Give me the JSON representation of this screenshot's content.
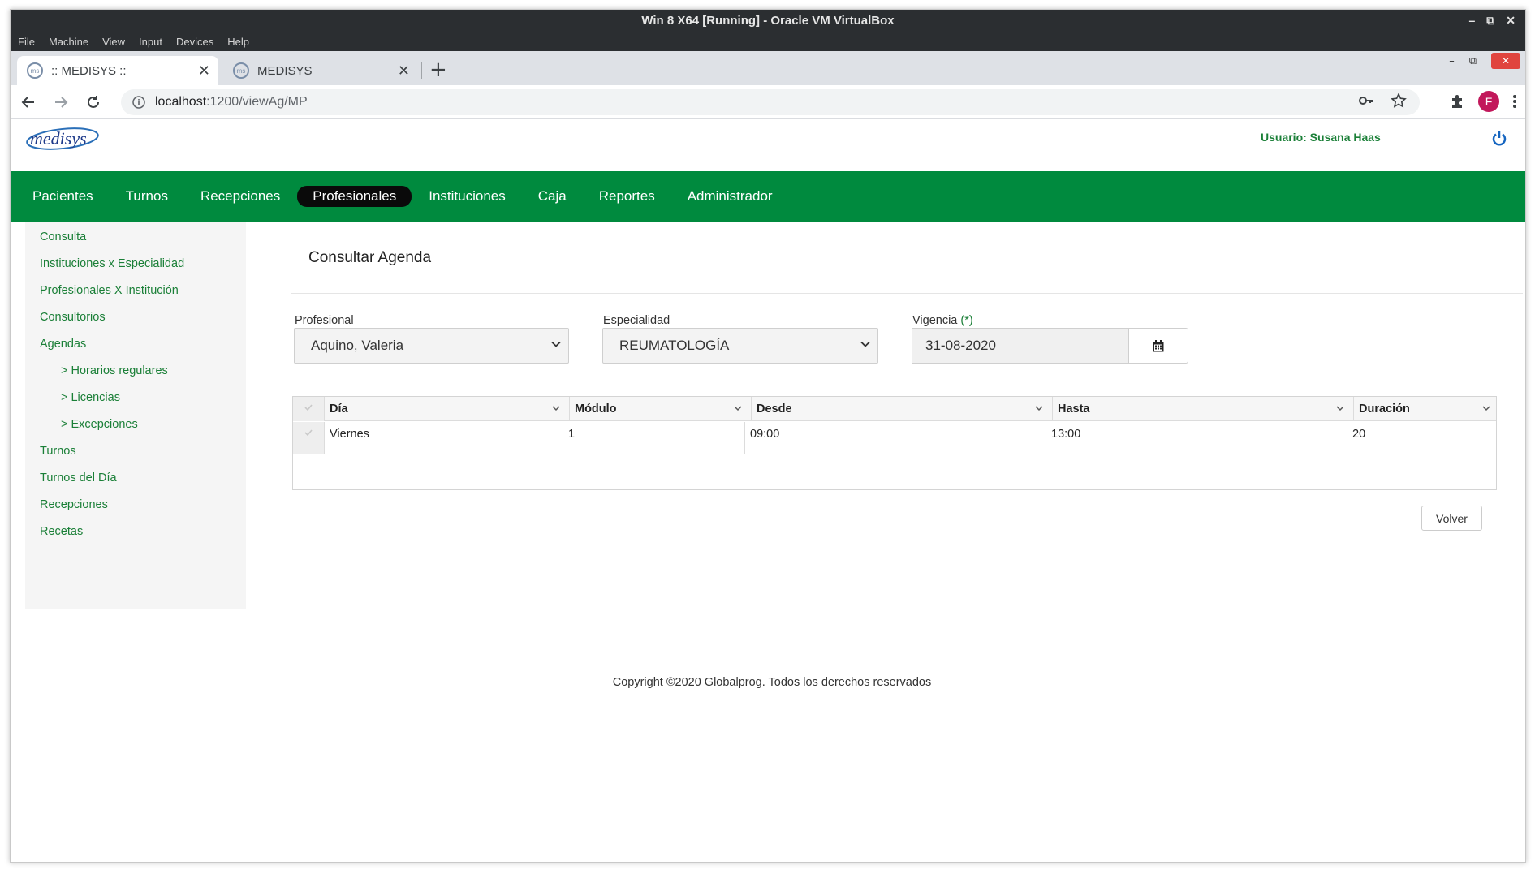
{
  "vbox": {
    "title": "Win 8 X64 [Running] - Oracle VM VirtualBox",
    "menu": [
      "File",
      "Machine",
      "View",
      "Input",
      "Devices",
      "Help"
    ]
  },
  "browser": {
    "tabs": [
      {
        "title": ":: MEDISYS ::",
        "active": true
      },
      {
        "title": "MEDISYS",
        "active": false
      }
    ],
    "url_host": "localhost",
    "url_path": ":1200/viewAg/MP",
    "profile_initial": "F"
  },
  "app": {
    "logo_text": "medisys",
    "user_label": "Usuario: Susana Haas",
    "nav": [
      "Pacientes",
      "Turnos",
      "Recepciones",
      "Profesionales",
      "Instituciones",
      "Caja",
      "Reportes",
      "Administrador"
    ],
    "nav_active": "Profesionales",
    "sidebar": [
      {
        "label": "Consulta",
        "sub": false
      },
      {
        "label": "Instituciones x Especialidad",
        "sub": false
      },
      {
        "label": "Profesionales X Institución",
        "sub": false
      },
      {
        "label": "Consultorios",
        "sub": false
      },
      {
        "label": "Agendas",
        "sub": false
      },
      {
        "label": "> Horarios regulares",
        "sub": true
      },
      {
        "label": "> Licencias",
        "sub": true
      },
      {
        "label": "> Excepciones",
        "sub": true
      },
      {
        "label": "Turnos",
        "sub": false
      },
      {
        "label": "Turnos del Día",
        "sub": false
      },
      {
        "label": "Recepciones",
        "sub": false
      },
      {
        "label": "Recetas",
        "sub": false
      }
    ]
  },
  "form": {
    "title": "Consultar Agenda",
    "profesional_label": "Profesional",
    "profesional_value": "Aquino, Valeria",
    "especialidad_label": "Especialidad",
    "especialidad_value": "REUMATOLOGÍA",
    "vigencia_label": "Vigencia",
    "vigencia_req": "(*)",
    "vigencia_value": "31-08-2020"
  },
  "grid": {
    "columns": [
      "Día",
      "Módulo",
      "Desde",
      "Hasta",
      "Duración"
    ],
    "rows": [
      [
        "Viernes",
        "1",
        "09:00",
        "13:00",
        "20"
      ]
    ]
  },
  "buttons": {
    "volver": "Volver"
  },
  "footer": {
    "text": "Copyright ©2020 Globalprog. Todos los derechos reservados"
  },
  "colors": {
    "brand_green": "#008a3e",
    "link_green": "#1a7f37",
    "active_nav": "#0a0a0a"
  }
}
